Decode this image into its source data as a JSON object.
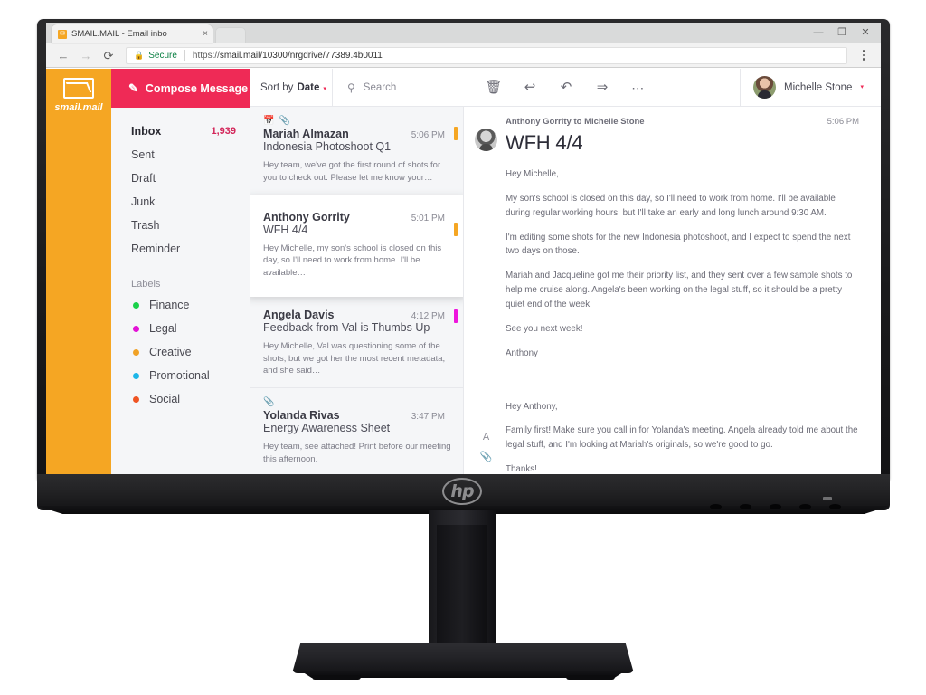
{
  "browser": {
    "tab": {
      "favicon": "mail-favicon",
      "title": "SMAIL.MAIL - Email inbo",
      "close": "×"
    },
    "nav": {
      "back": "←",
      "forward": "→",
      "reload": "⟳"
    },
    "omnibox": {
      "lock": "🔒",
      "secure_label": "Secure",
      "url_scheme": "https://",
      "url_rest": "smail.mail/10300/nrgdrive/77389.4b0011"
    },
    "window_controls": {
      "minimize": "—",
      "restore": "❐",
      "close": "✕"
    },
    "menu": "kebab-menu"
  },
  "app": {
    "brand": {
      "icon": "envelope-icon",
      "name": "smail.mail"
    },
    "compose": {
      "icon": "compose-pencil-icon",
      "label": "Compose Message"
    },
    "folders": [
      {
        "label": "Inbox",
        "count": "1,939",
        "active": true
      },
      {
        "label": "Sent",
        "count": "",
        "active": false
      },
      {
        "label": "Draft",
        "count": "",
        "active": false
      },
      {
        "label": "Junk",
        "count": "",
        "active": false
      },
      {
        "label": "Trash",
        "count": "",
        "active": false
      },
      {
        "label": "Reminder",
        "count": "",
        "active": false
      }
    ],
    "labels_title": "Labels",
    "labels": [
      {
        "label": "Finance",
        "color": "#1ad14a"
      },
      {
        "label": "Legal",
        "color": "#e312d6"
      },
      {
        "label": "Creative",
        "color": "#f0a227"
      },
      {
        "label": "Promotional",
        "color": "#1cb6e8"
      },
      {
        "label": "Social",
        "color": "#ef5423"
      }
    ],
    "sort": {
      "label": "Sort by",
      "value": "Date",
      "caret": "▾"
    },
    "search": {
      "icon": "search-icon",
      "label": "Search"
    },
    "toolbar": {
      "delete": "trash-icon",
      "reply": "reply-icon",
      "reply_all": "reply-all-icon",
      "forward": "forward-icon",
      "more": "more-dots-icon"
    },
    "user": {
      "name": "Michelle Stone",
      "caret": "▾",
      "avatar": "michelle-stone-avatar"
    },
    "messages": [
      {
        "sender": "Mariah Almazan",
        "subject": "Indonesia Photoshoot Q1",
        "time": "5:06 PM",
        "preview": "Hey team, we've got the first round of shots for you to check out. Please let me know your…",
        "strip_color": "#f5a623",
        "icons": [
          "calendar-icon",
          "paperclip-icon"
        ],
        "selected": false
      },
      {
        "sender": "Anthony Gorrity",
        "subject": "WFH 4/4",
        "time": "5:01 PM",
        "preview": "Hey Michelle, my son's school is closed on this day, so I'll need to work from home. I'll be available…",
        "strip_color": "#f5a623",
        "icons": [],
        "selected": true
      },
      {
        "sender": "Angela Davis",
        "subject": "Feedback from Val is Thumbs Up",
        "time": "4:12 PM",
        "preview": "Hey Michelle, Val was questioning some of the shots, but we got her the most recent metadata, and she said…",
        "strip_color": "#ee16dd",
        "icons": [],
        "selected": false
      },
      {
        "sender": "Yolanda Rivas",
        "subject": "Energy Awareness Sheet",
        "time": "3:47 PM",
        "preview": "Hey team, see attached! Print before our meeting this afternoon.",
        "strip_color": "",
        "icons": [
          "paperclip-icon"
        ],
        "selected": false
      }
    ],
    "reading": {
      "from": "Anthony Gorrity to Michelle Stone",
      "time": "5:06 PM",
      "subject": "WFH 4/4",
      "paragraphs": [
        "Hey Michelle,",
        "My son's school is closed on this day, so I'll need to work from home. I'll be available during regular working hours, but I'll take an early and long lunch around 9:30 AM.",
        "I'm editing some shots for the new Indonesia photoshoot, and I expect to spend the next two days on those.",
        "Mariah and Jacqueline got me their priority list, and they sent over a few sample shots to help me cruise along. Angela's been working on the legal stuff, so it should be a pretty quiet end of the week.",
        "See you next week!",
        "Anthony"
      ],
      "reply": {
        "icons": [
          "font-format-icon",
          "attach-paperclip-icon"
        ],
        "paragraphs": [
          "Hey Anthony,",
          "Family first! Make sure you call in for Yolanda's meeting. Angela already told me about the legal stuff, and I'm looking at Mariah's originals, so we're good to go.",
          "Thanks!"
        ]
      }
    }
  },
  "hardware": {
    "brand_logo": "hp"
  }
}
